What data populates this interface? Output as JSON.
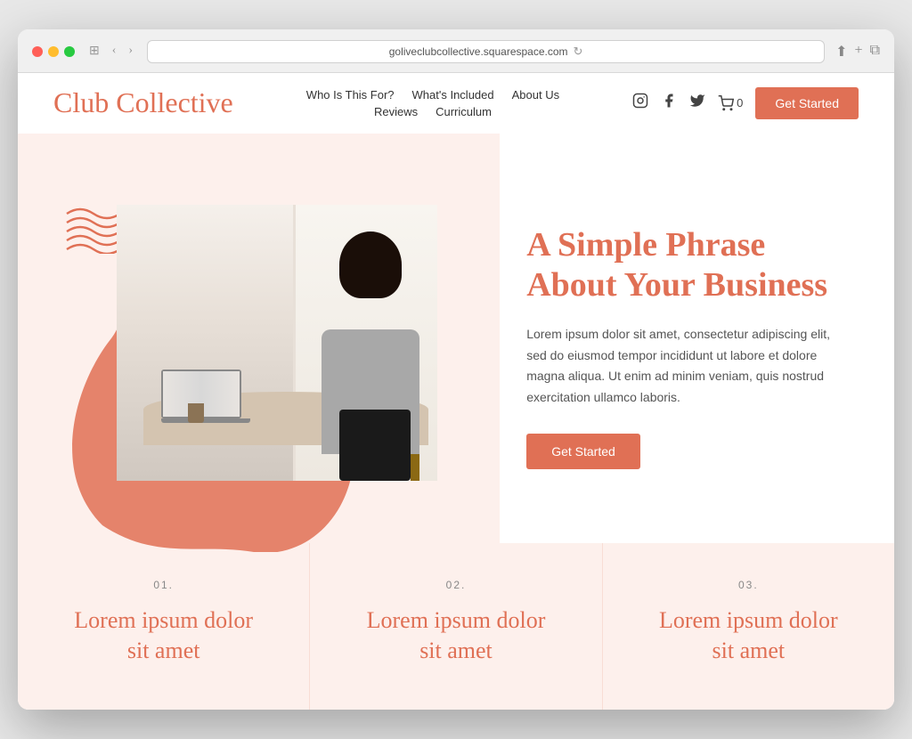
{
  "browser": {
    "url": "goliveclubcollective.squarespace.com"
  },
  "header": {
    "logo": "Club Collective",
    "nav": {
      "row1": [
        {
          "label": "Who Is This For?"
        },
        {
          "label": "What's Included"
        },
        {
          "label": "About Us"
        }
      ],
      "row2": [
        {
          "label": "Reviews"
        },
        {
          "label": "Curriculum"
        }
      ]
    },
    "cart_label": "0",
    "get_started": "Get Started"
  },
  "hero": {
    "heading_line1": "A Simple Phrase",
    "heading_line2": "About Your Business",
    "body_text": "Lorem ipsum dolor sit amet, consectetur adipiscing elit, sed do eiusmod tempor incididunt ut labore et dolore magna aliqua. Ut enim ad minim veniam, quis nostrud exercitation ullamco laboris.",
    "cta_label": "Get Started"
  },
  "features": [
    {
      "number": "01.",
      "title_line1": "Lorem ipsum dolor",
      "title_line2": "sit amet"
    },
    {
      "number": "02.",
      "title_line1": "Lorem ipsum dolor",
      "title_line2": "sit amet"
    },
    {
      "number": "03.",
      "title_line1": "Lorem ipsum dolor",
      "title_line2": "sit amet"
    }
  ],
  "colors": {
    "brand_coral": "#e07055",
    "bg_peach": "#fdf0ec"
  }
}
